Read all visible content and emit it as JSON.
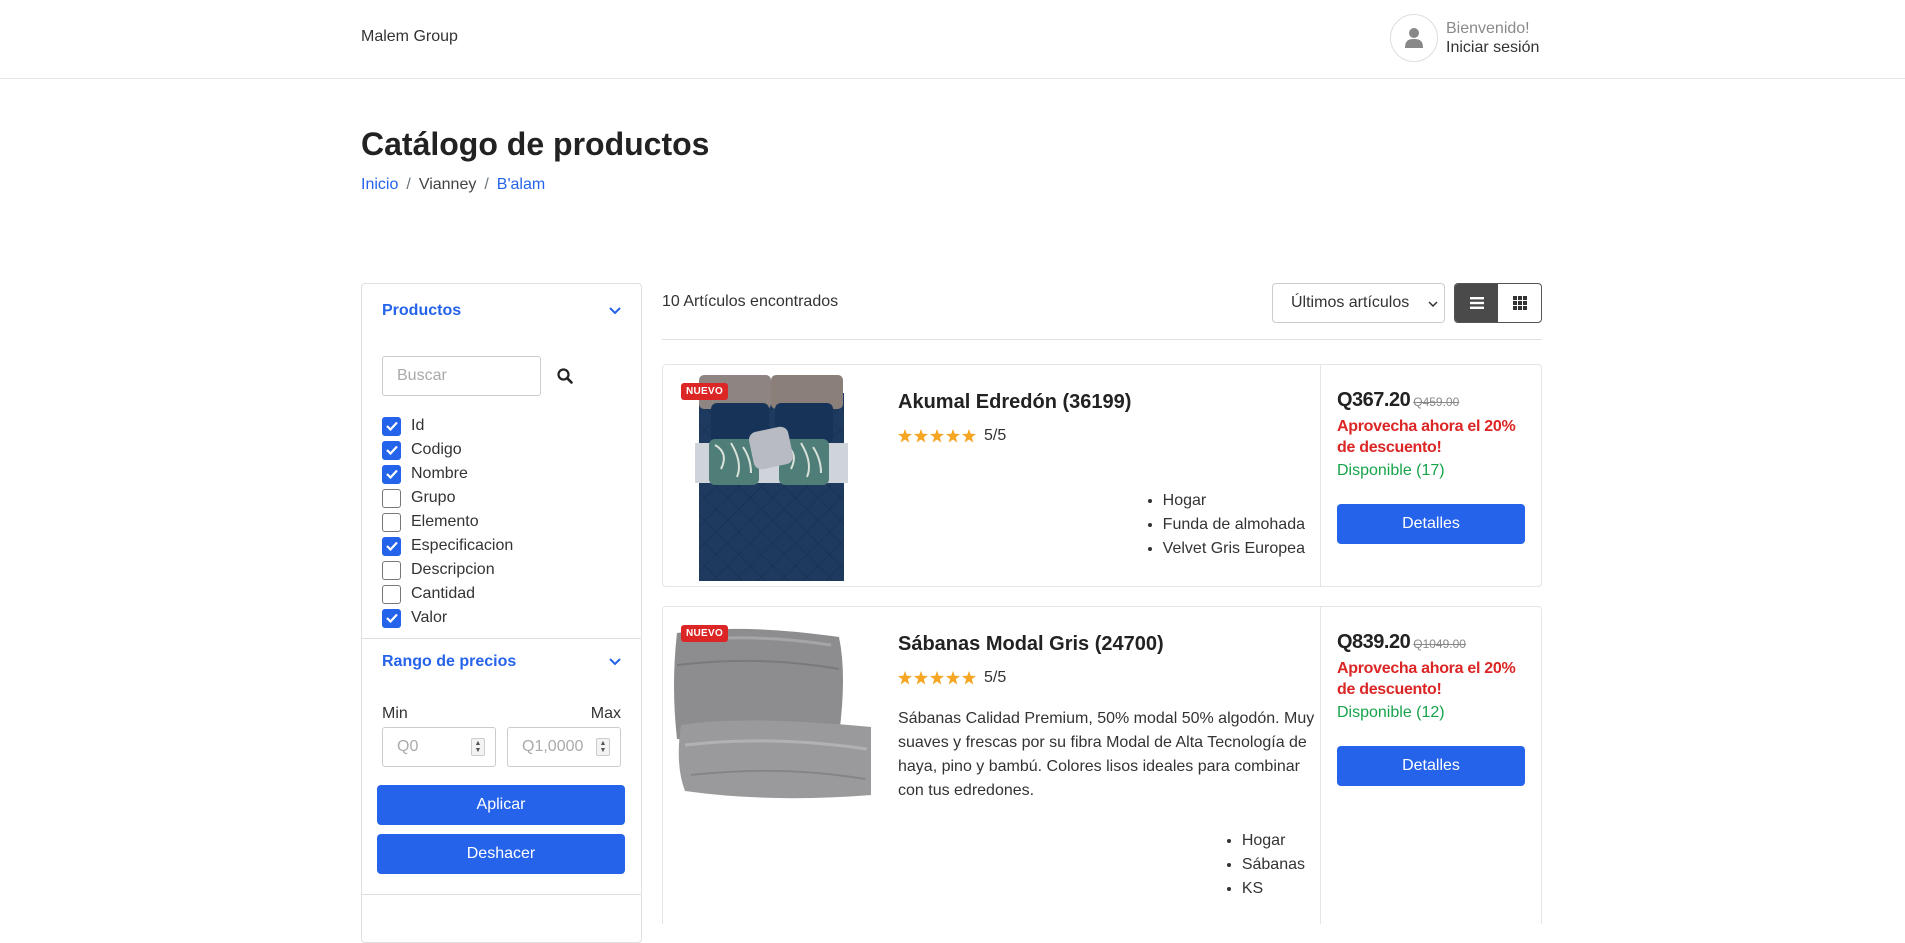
{
  "header": {
    "brand": "Malem Group",
    "greeting": "Bienvenido!",
    "login": "Iniciar sesión"
  },
  "page": {
    "title": "Catálogo de productos",
    "breadcrumb": [
      "Inicio",
      "Vianney",
      "B'alam"
    ]
  },
  "sidebar": {
    "products_title": "Productos",
    "search_placeholder": "Buscar",
    "checkboxes": [
      {
        "label": "Id",
        "checked": true
      },
      {
        "label": "Codigo",
        "checked": true
      },
      {
        "label": "Nombre",
        "checked": true
      },
      {
        "label": "Grupo",
        "checked": false
      },
      {
        "label": "Elemento",
        "checked": false
      },
      {
        "label": "Especificacion",
        "checked": true
      },
      {
        "label": "Descripcion",
        "checked": false
      },
      {
        "label": "Cantidad",
        "checked": false
      },
      {
        "label": "Valor",
        "checked": true
      }
    ],
    "price_range_title": "Rango de precios",
    "min_label": "Min",
    "max_label": "Max",
    "min_placeholder": "Q0",
    "max_placeholder": "Q1,0000",
    "apply_label": "Aplicar",
    "reset_label": "Deshacer"
  },
  "results": {
    "count_text": "10 Artículos encontrados",
    "sort_selected": "Últimos artículos"
  },
  "products": [
    {
      "badge": "NUEVO",
      "title": "Akumal Edredón (36199)",
      "rating": "5/5",
      "description": "",
      "tags": [
        "Hogar",
        "Funda de almohada",
        "Velvet Gris Europea"
      ],
      "price": "Q367.20",
      "old_price": "Q459.00",
      "promo": "Aprovecha ahora el 20% de descuento!",
      "stock": "Disponible (17)",
      "button": "Detalles"
    },
    {
      "badge": "NUEVO",
      "title": "Sábanas Modal Gris (24700)",
      "rating": "5/5",
      "description": "Sábanas Calidad Premium, 50% modal 50% algodón. Muy suaves y frescas por su fibra Modal de Alta Tecnología de haya, pino y bambú. Colores lisos ideales para combinar con tus edredones.",
      "tags": [
        "Hogar",
        "Sábanas",
        "KS"
      ],
      "price": "Q839.20",
      "old_price": "Q1049.00",
      "promo": "Aprovecha ahora el 20% de descuento!",
      "stock": "Disponible (12)",
      "button": "Detalles"
    }
  ],
  "colors": {
    "accent": "#2563eb",
    "promo": "#dc2626",
    "stock": "#16a34a",
    "star": "#f5a623"
  }
}
